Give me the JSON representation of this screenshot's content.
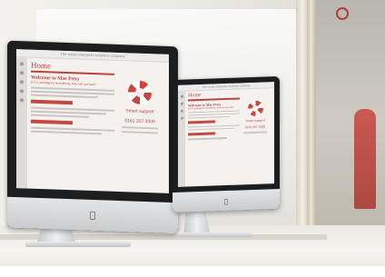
{
  "screen_left": {
    "topbar": "The social enterprise solutions company",
    "home_title": "Home",
    "welcome": "Welcome to Mae Petty",
    "subtitle": "ICT is exciting for everything, how can you see?",
    "side_text": "Smart support",
    "side_phone": "0161 207 2000"
  },
  "screen_right": {
    "topbar": "The social enterprise solutions company",
    "home_title": "Home",
    "welcome": "Welcome to Mae Petty",
    "subtitle": "ICT is exciting for everything, how can you see?",
    "side_text": "Smart support",
    "side_phone": "0161 207 2000"
  },
  "colors": {
    "accent": "#b8423c",
    "bezel": "#1d1e20",
    "aluminium": "#d9dbdc"
  },
  "icons": {
    "brand_logo": "apple-logo-icon",
    "lifebuoy": "lifebuoy-icon"
  }
}
